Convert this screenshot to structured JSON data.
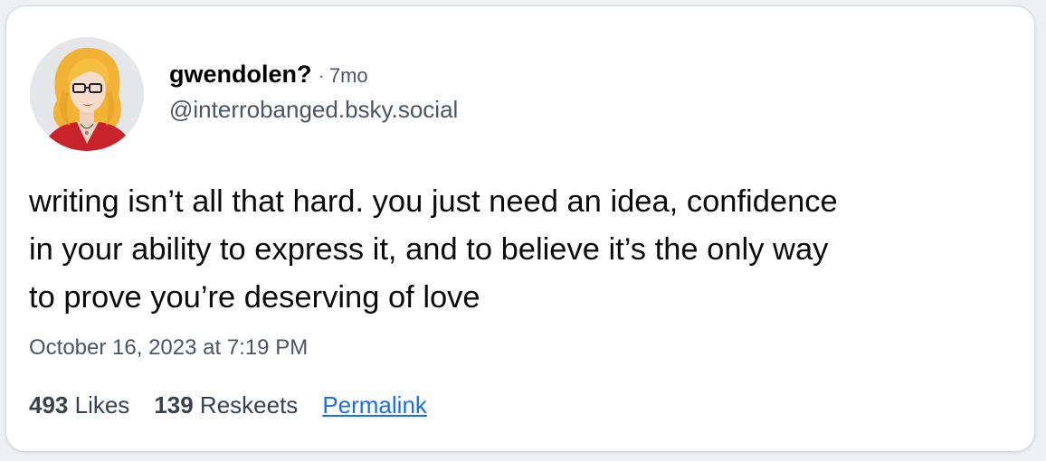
{
  "post": {
    "author": {
      "display_name": "gwendolen?",
      "handle": "@interrobanged.bsky.social",
      "avatar_icon": "illustrated-woman-avatar"
    },
    "separator": "·",
    "relative_time": "7mo",
    "text": "writing isn’t all that hard. you just need an idea, confidence\nin your ability to express it, and to believe it’s the only way\nto prove you’re deserving of love",
    "timestamp": "October 16, 2023 at 7:19 PM",
    "stats": {
      "likes_count": "493",
      "likes_label": "Likes",
      "reskeets_count": "139",
      "reskeets_label": "Reskeets",
      "permalink_label": "Permalink"
    }
  },
  "colors": {
    "link": "#1d6ee6",
    "muted_text": "#4b5563",
    "card_border": "#d6dae0"
  }
}
